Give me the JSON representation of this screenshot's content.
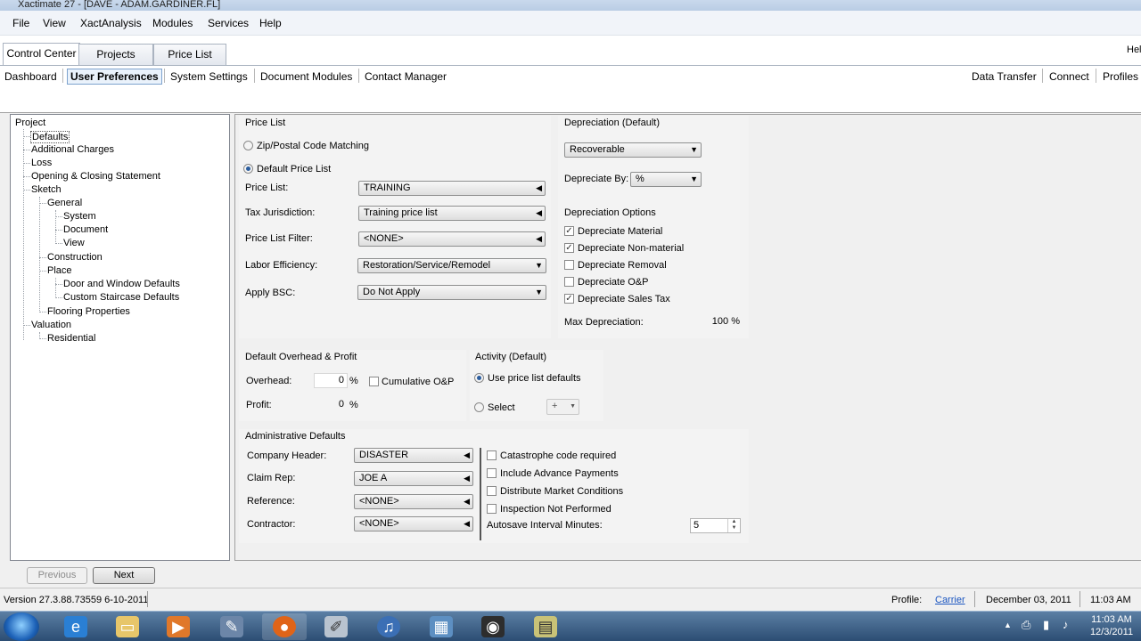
{
  "window": {
    "title": "Xactimate 27 - [DAVE - ADAM.GARDINER.FL]"
  },
  "menu": [
    "File",
    "View",
    "XactAnalysis",
    "Modules",
    "Services",
    "Help"
  ],
  "top_tabs": [
    "Control Center",
    "Projects",
    "Price List"
  ],
  "help_cut": "Hel",
  "subnav_left": [
    "Dashboard",
    "User Preferences",
    "System Settings",
    "Document Modules",
    "Contact Manager"
  ],
  "subnav_right": [
    "Data Transfer",
    "Connect",
    "Profiles"
  ],
  "tree": {
    "root": "Project",
    "items": [
      "Defaults",
      "Additional Charges",
      "Loss",
      "Opening & Closing Statement",
      "Sketch",
      "General",
      "System",
      "Document",
      "View",
      "Construction",
      "Place",
      "Door and Window Defaults",
      "Custom Staircase Defaults",
      "Flooring Properties",
      "Valuation",
      "Residential"
    ]
  },
  "price_list": {
    "header": "Price List",
    "zip_label": "Zip/Postal Code Matching",
    "default_label": "Default Price List",
    "fields": [
      {
        "label": "Price List:",
        "value": "TRAINING"
      },
      {
        "label": "Tax Jurisdiction:",
        "value": "Training price list"
      },
      {
        "label": "Price List Filter:",
        "value": "<NONE>"
      },
      {
        "label": "Labor Efficiency:",
        "value": "Restoration/Service/Remodel"
      },
      {
        "label": "Apply BSC:",
        "value": "Do Not Apply"
      }
    ]
  },
  "depreciation": {
    "header": "Depreciation (Default)",
    "type_value": "Recoverable",
    "by_label": "Depreciate By:",
    "by_value": "%",
    "options_header": "Depreciation Options",
    "options": [
      {
        "label": "Depreciate Material",
        "checked": true
      },
      {
        "label": "Depreciate Non-material",
        "checked": true
      },
      {
        "label": "Depreciate Removal",
        "checked": false
      },
      {
        "label": "Depreciate O&P",
        "checked": false
      },
      {
        "label": "Depreciate Sales Tax",
        "checked": true
      }
    ],
    "max_label": "Max Depreciation:",
    "max_value": "100 %"
  },
  "overhead": {
    "header": "Default Overhead & Profit",
    "overhead_label": "Overhead:",
    "overhead_value": "0",
    "profit_label": "Profit:",
    "profit_value": "0",
    "pct": "%",
    "cumulative_label": "Cumulative O&P"
  },
  "activity": {
    "header": "Activity (Default)",
    "use_defaults": "Use price list defaults",
    "select": "Select",
    "select_value": "+"
  },
  "admin": {
    "header": "Administrative Defaults",
    "fields": [
      {
        "label": "Company Header:",
        "value": "DISASTER"
      },
      {
        "label": "Claim Rep:",
        "value": "JOE A"
      },
      {
        "label": "Reference:",
        "value": "<NONE>"
      },
      {
        "label": "Contractor:",
        "value": "<NONE>"
      }
    ],
    "checks": [
      "Catastrophe code required",
      "Include Advance Payments",
      "Distribute Market Conditions",
      "Inspection Not Performed"
    ],
    "autosave_label": "Autosave Interval Minutes:",
    "autosave_value": "5"
  },
  "nav_buttons": {
    "previous": "Previous",
    "next": "Next"
  },
  "status": {
    "version": "Version 27.3.88.73559 6-10-2011",
    "profile_label": "Profile:",
    "profile_link": "Carrier",
    "date": "December 03, 2011",
    "time": "11:03 AM"
  },
  "taskbar": {
    "clock_time": "11:03 AM",
    "clock_date": "12/3/2011",
    "apps": [
      "internet-explorer-icon",
      "folder-icon",
      "media-player-icon",
      "xactimate-icon",
      "firefox-icon",
      "pencil-icon",
      "itunes-icon",
      "network-icon",
      "camera-icon",
      "notes-icon"
    ]
  }
}
